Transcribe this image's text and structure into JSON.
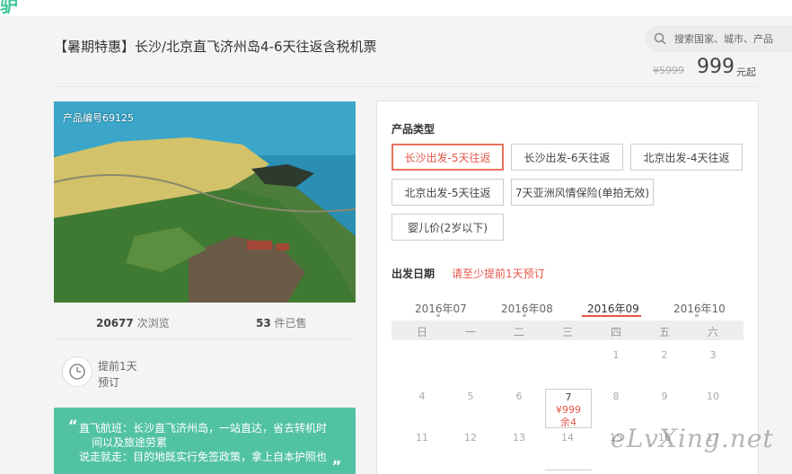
{
  "header": {
    "logo": "驴",
    "search_placeholder": "搜索国家、城市、产品"
  },
  "product": {
    "title": "【暑期特惠】长沙/北京直飞济州岛4-6天往返含税机票",
    "old_price": "¥5999",
    "price": "999",
    "price_suffix": "元起",
    "code": "产品编号69125",
    "views_count": "20677",
    "views_label": "次浏览",
    "sold_count": "53",
    "sold_label": "件已售",
    "advance_line1": "提前1天",
    "advance_line2": "预订"
  },
  "promo": {
    "line1": "直飞航班：长沙直飞济州岛，一站直达，省去转机时",
    "line2": "间以及旅途劳累",
    "line3": "说走就走：目的地既实行免签政策，拿上自本护照也",
    "quote_open": "“",
    "quote_close": "„"
  },
  "booking": {
    "type_label": "产品类型",
    "options": [
      "长沙出发-5天往返",
      "长沙出发-6天往返",
      "北京出发-4天往返",
      "北京出发-5天往返",
      "7天亚洲风情保险(单拍无效)",
      "婴儿价(2岁以下)"
    ],
    "selected_index": 0,
    "date_label": "出发日期",
    "date_hint": "请至少提前1天预订",
    "months": [
      "2016年07",
      "2016年08",
      "2016年09",
      "2016年10"
    ],
    "active_month": "2016年09",
    "weekdays": [
      "日",
      "一",
      "二",
      "三",
      "四",
      "五",
      "六"
    ],
    "row1": [
      "1",
      "2",
      "3"
    ],
    "row2": [
      "4",
      "5",
      "6",
      "7",
      "8",
      "9",
      "10"
    ],
    "row3": [
      "11",
      "12",
      "13",
      "14",
      "15",
      "16",
      "17"
    ],
    "highlight_day": {
      "day": "7",
      "price": "¥999",
      "remaining": "余4"
    }
  },
  "watermark": "eLvXing.net",
  "colors": {
    "accent_red": "#e4574a",
    "promo_green": "#52c3a2"
  }
}
